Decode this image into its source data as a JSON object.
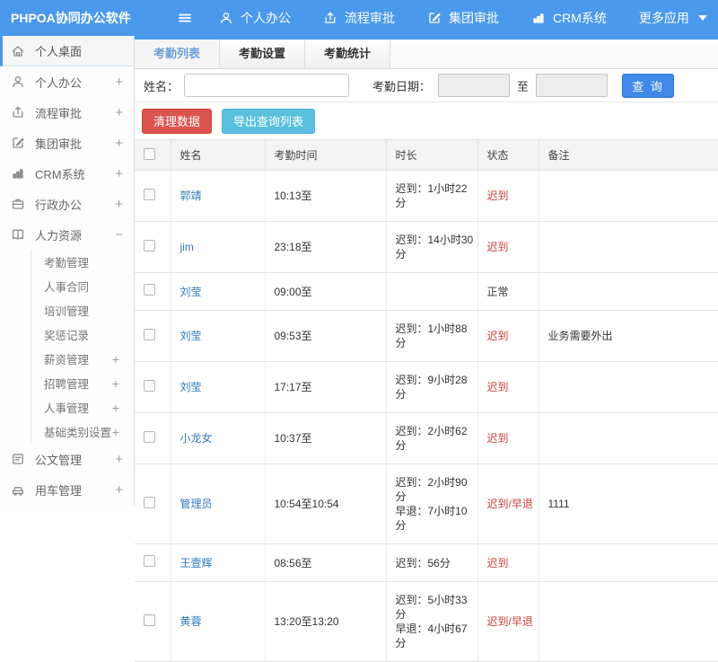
{
  "colors": {
    "header_blue": "#4b99ec",
    "link_blue": "#3179bd",
    "active_tab_blue": "#6d9eda",
    "danger_red": "#d9534f",
    "info_teal": "#5bc0de",
    "query_blue": "#4189e8",
    "status_red": "#d0403c"
  },
  "topbar": {
    "title": "PHPOA协同办公软件",
    "menu_icon": "hamburger-menu-icon",
    "nav": [
      {
        "label": "个人办公",
        "icon": "user-icon"
      },
      {
        "label": "流程审批",
        "icon": "process-icon"
      },
      {
        "label": "集团审批",
        "icon": "edit-icon"
      },
      {
        "label": "CRM系统",
        "icon": "chart-icon"
      },
      {
        "label": "更多应用",
        "icon": "caret-down-icon",
        "caret": true
      }
    ]
  },
  "sidebar": {
    "items": [
      {
        "label": "个人桌面",
        "icon": "home-icon",
        "active": true
      },
      {
        "label": "个人办公",
        "icon": "user-icon",
        "expand": "+"
      },
      {
        "label": "流程审批",
        "icon": "process-icon",
        "expand": "+"
      },
      {
        "label": "集团审批",
        "icon": "edit-icon",
        "expand": "+"
      },
      {
        "label": "CRM系统",
        "icon": "chart-icon",
        "expand": "+"
      },
      {
        "label": "行政办公",
        "icon": "briefcase-icon",
        "expand": "+"
      },
      {
        "label": "人力资源",
        "icon": "book-icon",
        "expand": "−",
        "children": [
          {
            "label": "考勤管理"
          },
          {
            "label": "人事合同"
          },
          {
            "label": "培训管理"
          },
          {
            "label": "奖惩记录"
          },
          {
            "label": "薪资管理",
            "expand": "+"
          },
          {
            "label": "招聘管理",
            "expand": "+"
          },
          {
            "label": "人事管理",
            "expand": "+"
          },
          {
            "label": "基础类别设置",
            "expand": "+"
          }
        ]
      },
      {
        "label": "公文管理",
        "icon": "doc-icon",
        "expand": "+"
      },
      {
        "label": "用车管理",
        "icon": "car-icon",
        "expand": "+"
      }
    ]
  },
  "tabs": [
    {
      "label": "考勤列表",
      "active": true
    },
    {
      "label": "考勤设置",
      "active": false
    },
    {
      "label": "考勤统计",
      "active": false
    }
  ],
  "search": {
    "name_label": "姓名：",
    "name_value": "",
    "date_label": "考勤日期：",
    "date_from_value": "",
    "to_label": "至",
    "date_to_value": "",
    "query_button": "查 询"
  },
  "actions": {
    "clean_button": "清理数据",
    "export_button": "导出查询列表"
  },
  "table": {
    "headers": [
      "姓名",
      "考勤时间",
      "时长",
      "状态",
      "备注"
    ],
    "rows": [
      {
        "name": "郭靖",
        "time": "10:13至",
        "duration": [
          "迟到：1小时22分"
        ],
        "status": "迟到",
        "status_type": "late",
        "remark": ""
      },
      {
        "name": "jim",
        "time": "23:18至",
        "duration": [
          "迟到：14小时30分"
        ],
        "status": "迟到",
        "status_type": "late",
        "remark": ""
      },
      {
        "name": "刘莹",
        "time": "09:00至",
        "duration": [],
        "status": "正常",
        "status_type": "normal",
        "remark": ""
      },
      {
        "name": "刘莹",
        "time": "09:53至",
        "duration": [
          "迟到：1小时88分"
        ],
        "status": "迟到",
        "status_type": "late",
        "remark": "业务需要外出"
      },
      {
        "name": "刘莹",
        "time": "17:17至",
        "duration": [
          "迟到：9小时28分"
        ],
        "status": "迟到",
        "status_type": "late",
        "remark": ""
      },
      {
        "name": "小龙女",
        "time": "10:37至",
        "duration": [
          "迟到：2小时62分"
        ],
        "status": "迟到",
        "status_type": "late",
        "remark": ""
      },
      {
        "name": "管理员",
        "time": "10:54至10:54",
        "duration": [
          "迟到：2小时90分",
          "早退：7小时10分"
        ],
        "status": "迟到/早退",
        "status_type": "late",
        "remark": "1111"
      },
      {
        "name": "王壹辉",
        "time": "08:56至",
        "duration": [
          "迟到：56分"
        ],
        "status": "迟到",
        "status_type": "late",
        "remark": ""
      },
      {
        "name": "黄蓉",
        "time": "13:20至13:20",
        "duration": [
          "迟到：5小时33分",
          "早退：4小时67分"
        ],
        "status": "迟到/早退",
        "status_type": "late",
        "remark": ""
      }
    ]
  }
}
